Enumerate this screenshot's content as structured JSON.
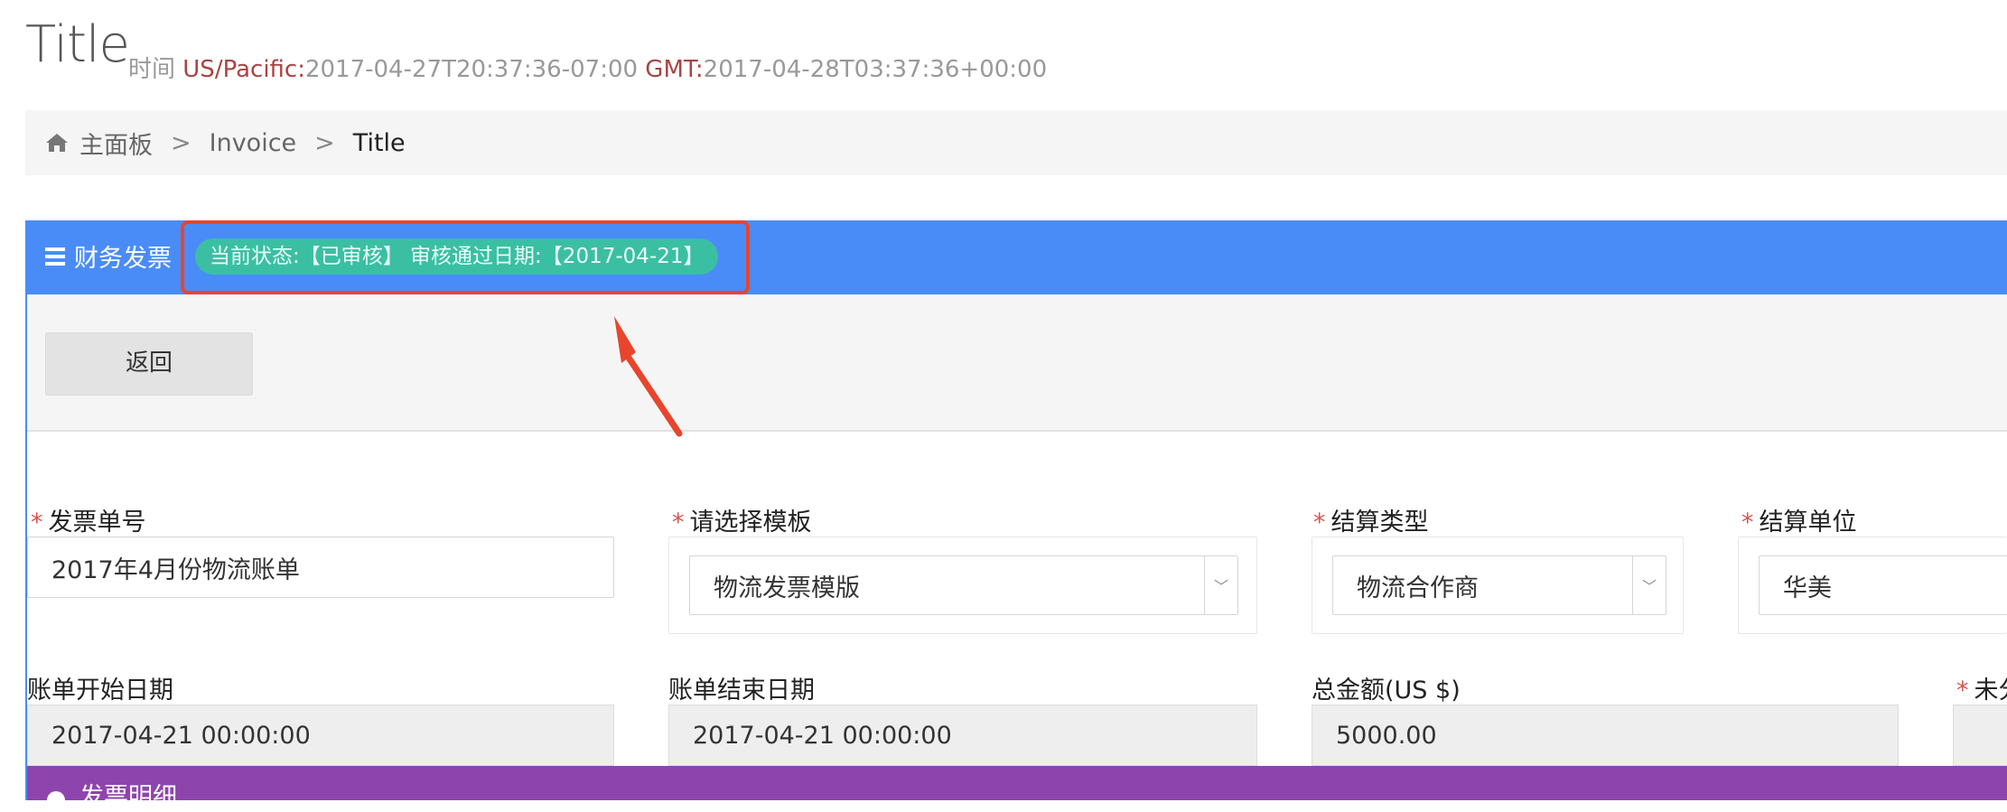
{
  "page": {
    "title": "Title",
    "time_label": "时间",
    "tz1_label": "US/Pacific:",
    "tz1_value": "2017-04-27T20:37:36-07:00",
    "tz2_label": "GMT:",
    "tz2_value": "2017-04-28T03:37:36+00:00"
  },
  "breadcrumb": {
    "home": "主面板",
    "items": [
      "Invoice",
      "Title"
    ],
    "separator": ">"
  },
  "panel": {
    "title": "财务发票",
    "status": "当前状态:【已审核】 审核通过日期:【2017-04-21】",
    "back_label": "返回"
  },
  "form": {
    "invoice_no": {
      "label": "发票单号",
      "value": "2017年4月份物流账单"
    },
    "template": {
      "label": "请选择模板",
      "value": "物流发票模版"
    },
    "settle_type": {
      "label": "结算类型",
      "value": "物流合作商"
    },
    "settle_unit": {
      "label": "结算单位",
      "value": "华美"
    },
    "start_date": {
      "label": "账单开始日期",
      "value": "2017-04-21 00:00:00"
    },
    "end_date": {
      "label": "账单结束日期",
      "value": "2017-04-21 00:00:00"
    },
    "total": {
      "label": "总金额(US $)",
      "value": "5000.00"
    },
    "unpaid": {
      "label": "未分"
    }
  },
  "detail": {
    "title": "发票明细"
  },
  "icons": {
    "home": "home-icon",
    "menu": "menu-icon",
    "caret": "chevron-down-icon"
  },
  "colors": {
    "primary": "#4a8cf7",
    "status": "#3bbfa3",
    "annotation": "#e8452c",
    "detail": "#8e44ad",
    "required": "#d9534f",
    "timezone": "#a94442"
  }
}
